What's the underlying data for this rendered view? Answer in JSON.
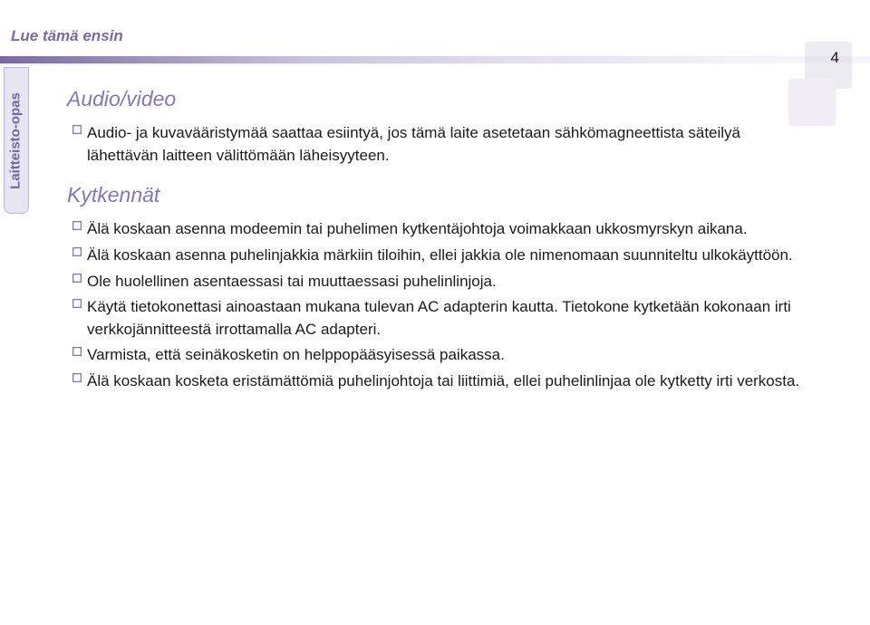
{
  "header": {
    "title": "Lue tämä ensin",
    "side_tab": "Laitteisto-opas",
    "page_number": "4"
  },
  "sections": {
    "audio_video": {
      "heading": "Audio/video",
      "items": [
        "Audio- ja kuvavääristymää saattaa esiintyä, jos tämä laite asetetaan sähkömagneettista säteilyä lähettävän laitteen välittömään läheisyyteen."
      ]
    },
    "kytkennat": {
      "heading": "Kytkennät",
      "items": [
        "Älä koskaan asenna modeemin tai puhelimen kytkentäjohtoja voimakkaan ukkosmyrskyn aikana.",
        "Älä koskaan asenna puhelinjakkia märkiin tiloihin, ellei jakkia ole nimenomaan suunniteltu ulkokäyttöön.",
        "Ole huolellinen asentaessasi tai muuttaessasi puhelinlinjoja.",
        "Käytä tietokonettasi ainoastaan mukana tulevan AC adapterin kautta. Tietokone kytketään kokonaan irti verkkojännitteestä irrottamalla AC adapteri.",
        "Varmista, että seinäkosketin on helppopääsyisessä paikassa.",
        "Älä koskaan kosketa eristämättömiä puhelinjohtoja tai liittimiä, ellei puhelinlinjaa ole kytketty irti verkosta."
      ]
    }
  }
}
